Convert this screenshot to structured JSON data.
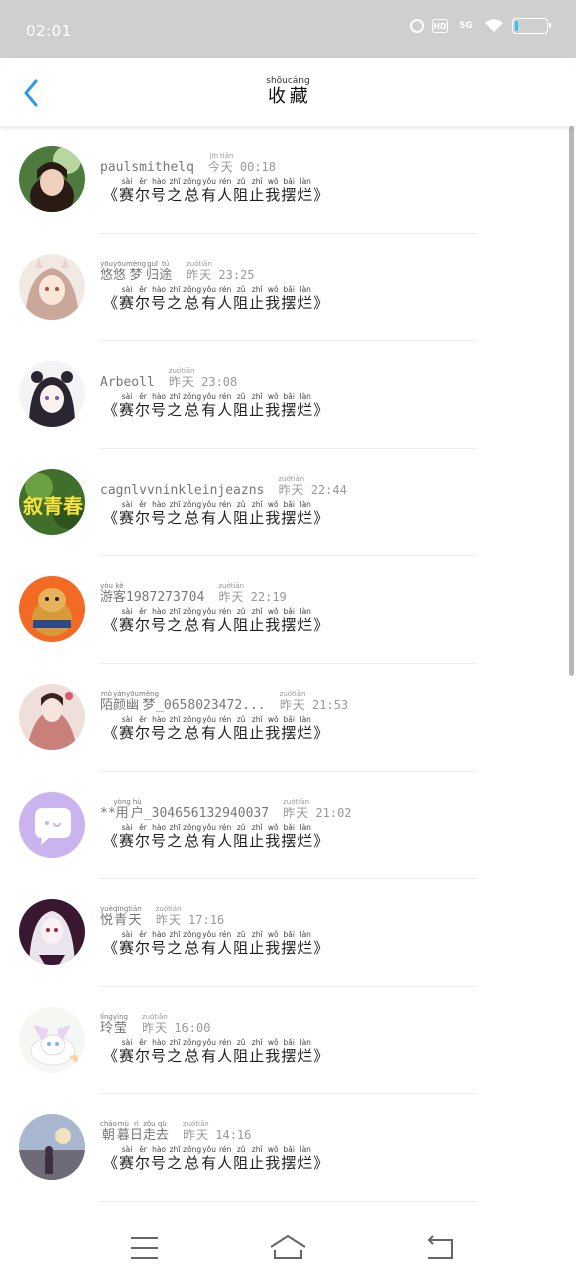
{
  "status": {
    "time": "02:01",
    "hd": "HD",
    "network": "5G"
  },
  "header": {
    "title": [
      {
        "c": "收",
        "p": "shōu"
      },
      {
        "c": "藏",
        "p": "cáng"
      }
    ]
  },
  "favorite_text": [
    {
      "c": "《",
      "p": ""
    },
    {
      "c": "赛",
      "p": "sài"
    },
    {
      "c": "尔",
      "p": "ěr"
    },
    {
      "c": "号",
      "p": "hào"
    },
    {
      "c": "之",
      "p": "zhī"
    },
    {
      "c": "总",
      "p": "zǒng"
    },
    {
      "c": "有",
      "p": "yǒu"
    },
    {
      "c": "人",
      "p": "rén"
    },
    {
      "c": "阻",
      "p": "zǔ"
    },
    {
      "c": "止",
      "p": "zhǐ"
    },
    {
      "c": "我",
      "p": "wǒ"
    },
    {
      "c": "摆",
      "p": "bǎi"
    },
    {
      "c": "烂",
      "p": "làn"
    },
    {
      "c": "》",
      "p": ""
    }
  ],
  "items": [
    {
      "avatar": "avatar-girl-photo",
      "name": [
        {
          "c": "paulsmithelq",
          "p": ""
        }
      ],
      "time": [
        {
          "c": "今",
          "p": "jīn"
        },
        {
          "c": "天",
          "p": "tiān"
        },
        {
          "c": " 00:18",
          "p": ""
        }
      ]
    },
    {
      "avatar": "avatar-anime-girl",
      "name": [
        {
          "c": "悠",
          "p": "yōu"
        },
        {
          "c": "悠",
          "p": "yōu"
        },
        {
          "c": "梦",
          "p": "mèng"
        },
        {
          "c": "归",
          "p": "guī"
        },
        {
          "c": "途",
          "p": "tú"
        }
      ],
      "time": [
        {
          "c": "昨",
          "p": "zuó"
        },
        {
          "c": "天",
          "p": "tiān"
        },
        {
          "c": " 23:25",
          "p": ""
        }
      ]
    },
    {
      "avatar": "avatar-anime-sketch",
      "name": [
        {
          "c": "Arbeoll",
          "p": ""
        }
      ],
      "time": [
        {
          "c": "昨",
          "p": "zuó"
        },
        {
          "c": "天",
          "p": "tiān"
        },
        {
          "c": " 23:08",
          "p": ""
        }
      ]
    },
    {
      "avatar": "avatar-green-text",
      "name": [
        {
          "c": "cagnlvvninkleinjeazns",
          "p": ""
        }
      ],
      "time": [
        {
          "c": "昨",
          "p": "zuó"
        },
        {
          "c": "天",
          "p": "tiān"
        },
        {
          "c": " 22:44",
          "p": ""
        }
      ]
    },
    {
      "avatar": "avatar-orange-cartoon",
      "name": [
        {
          "c": "游",
          "p": "yóu"
        },
        {
          "c": "客",
          "p": "kè"
        },
        {
          "c": "1987273704",
          "p": ""
        }
      ],
      "time": [
        {
          "c": "昨",
          "p": "zuó"
        },
        {
          "c": "天",
          "p": "tiān"
        },
        {
          "c": " 22:19",
          "p": ""
        }
      ]
    },
    {
      "avatar": "avatar-hanfu-girl",
      "name": [
        {
          "c": "陌",
          "p": "mò"
        },
        {
          "c": "颜",
          "p": "yán"
        },
        {
          "c": "幽",
          "p": "yōu"
        },
        {
          "c": "梦",
          "p": "mèng"
        },
        {
          "c": "_0658023472...",
          "p": ""
        }
      ],
      "time": [
        {
          "c": "昨",
          "p": "zuó"
        },
        {
          "c": "天",
          "p": "tiān"
        },
        {
          "c": " 21:53",
          "p": ""
        }
      ]
    },
    {
      "avatar": "avatar-default-chat",
      "name": [
        {
          "c": "**",
          "p": ""
        },
        {
          "c": "用",
          "p": "yòng"
        },
        {
          "c": "户",
          "p": "hù"
        },
        {
          "c": "_304656132940037",
          "p": ""
        }
      ],
      "time": [
        {
          "c": "昨",
          "p": "zuó"
        },
        {
          "c": "天",
          "p": "tiān"
        },
        {
          "c": " 21:02",
          "p": ""
        }
      ]
    },
    {
      "avatar": "avatar-dark-anime",
      "name": [
        {
          "c": "悦",
          "p": "yuè"
        },
        {
          "c": "青",
          "p": "qīng"
        },
        {
          "c": "天",
          "p": "tiān"
        }
      ],
      "time": [
        {
          "c": "昨",
          "p": "zuó"
        },
        {
          "c": "天",
          "p": "tiān"
        },
        {
          "c": " 17:16",
          "p": ""
        }
      ]
    },
    {
      "avatar": "avatar-fox-cartoon",
      "name": [
        {
          "c": "玲",
          "p": "líng"
        },
        {
          "c": "莹",
          "p": "yíng"
        }
      ],
      "time": [
        {
          "c": "昨",
          "p": "zuó"
        },
        {
          "c": "天",
          "p": "tiān"
        },
        {
          "c": " 16:00",
          "p": ""
        }
      ]
    },
    {
      "avatar": "avatar-sky-scene",
      "name": [
        {
          "c": "朝",
          "p": "cháo"
        },
        {
          "c": "暮",
          "p": "mù"
        },
        {
          "c": "日",
          "p": "rì"
        },
        {
          "c": "走",
          "p": "zǒu"
        },
        {
          "c": "去",
          "p": "qù"
        }
      ],
      "time": [
        {
          "c": "昨",
          "p": "zuó"
        },
        {
          "c": "天",
          "p": "tiān"
        },
        {
          "c": " 14:16",
          "p": ""
        }
      ]
    }
  ],
  "colors": {
    "accent": "#2d9be8",
    "status_bar": "#cfcfcf",
    "battery": "#37c3f0"
  }
}
